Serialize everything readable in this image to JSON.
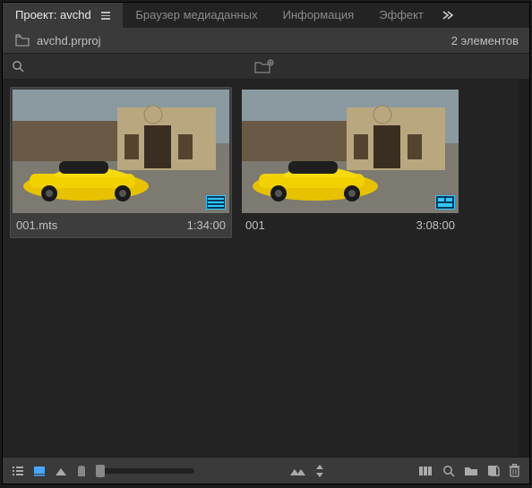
{
  "tabs": {
    "active": "Проект: avchd",
    "others": [
      "Браузер медиаданных",
      "Информация",
      "Эффект"
    ]
  },
  "project": {
    "filename": "avchd.prproj",
    "item_count": "2 элементов"
  },
  "search": {
    "placeholder": ""
  },
  "clips": [
    {
      "name": "001.mts",
      "duration": "1:34:00",
      "selected": true,
      "badge": "video"
    },
    {
      "name": "001",
      "duration": "3:08:00",
      "selected": false,
      "badge": "sequence"
    }
  ],
  "colors": {
    "accent": "#4aa8ff"
  }
}
